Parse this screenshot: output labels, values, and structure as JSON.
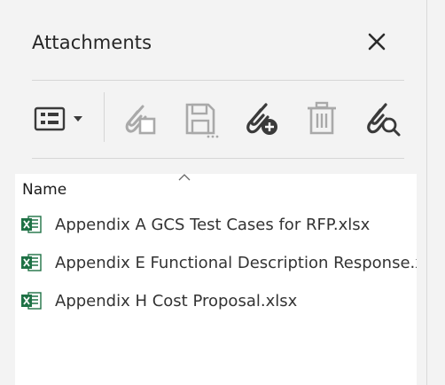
{
  "panel": {
    "title": "Attachments",
    "close_icon": "close-icon"
  },
  "toolbar": {
    "items": [
      {
        "name": "options-menu-icon",
        "enabled": true
      },
      {
        "name": "open-attachment-icon",
        "enabled": false
      },
      {
        "name": "save-attachment-icon",
        "enabled": false
      },
      {
        "name": "add-attachment-icon",
        "enabled": true
      },
      {
        "name": "delete-attachment-icon",
        "enabled": false
      },
      {
        "name": "search-attachment-icon",
        "enabled": true
      }
    ]
  },
  "list": {
    "column_header": "Name",
    "files": [
      {
        "name": "Appendix A GCS Test Cases for RFP.xlsx",
        "icon": "excel-file-icon"
      },
      {
        "name": "Appendix E Functional Description Response.xlsx",
        "icon": "excel-file-icon"
      },
      {
        "name": "Appendix H Cost Proposal.xlsx",
        "icon": "excel-file-icon"
      }
    ]
  },
  "colors": {
    "text": "#262626",
    "icon_enabled": "#3a3a3a",
    "icon_disabled": "#a9a9a9",
    "excel_green": "#1e7145"
  }
}
